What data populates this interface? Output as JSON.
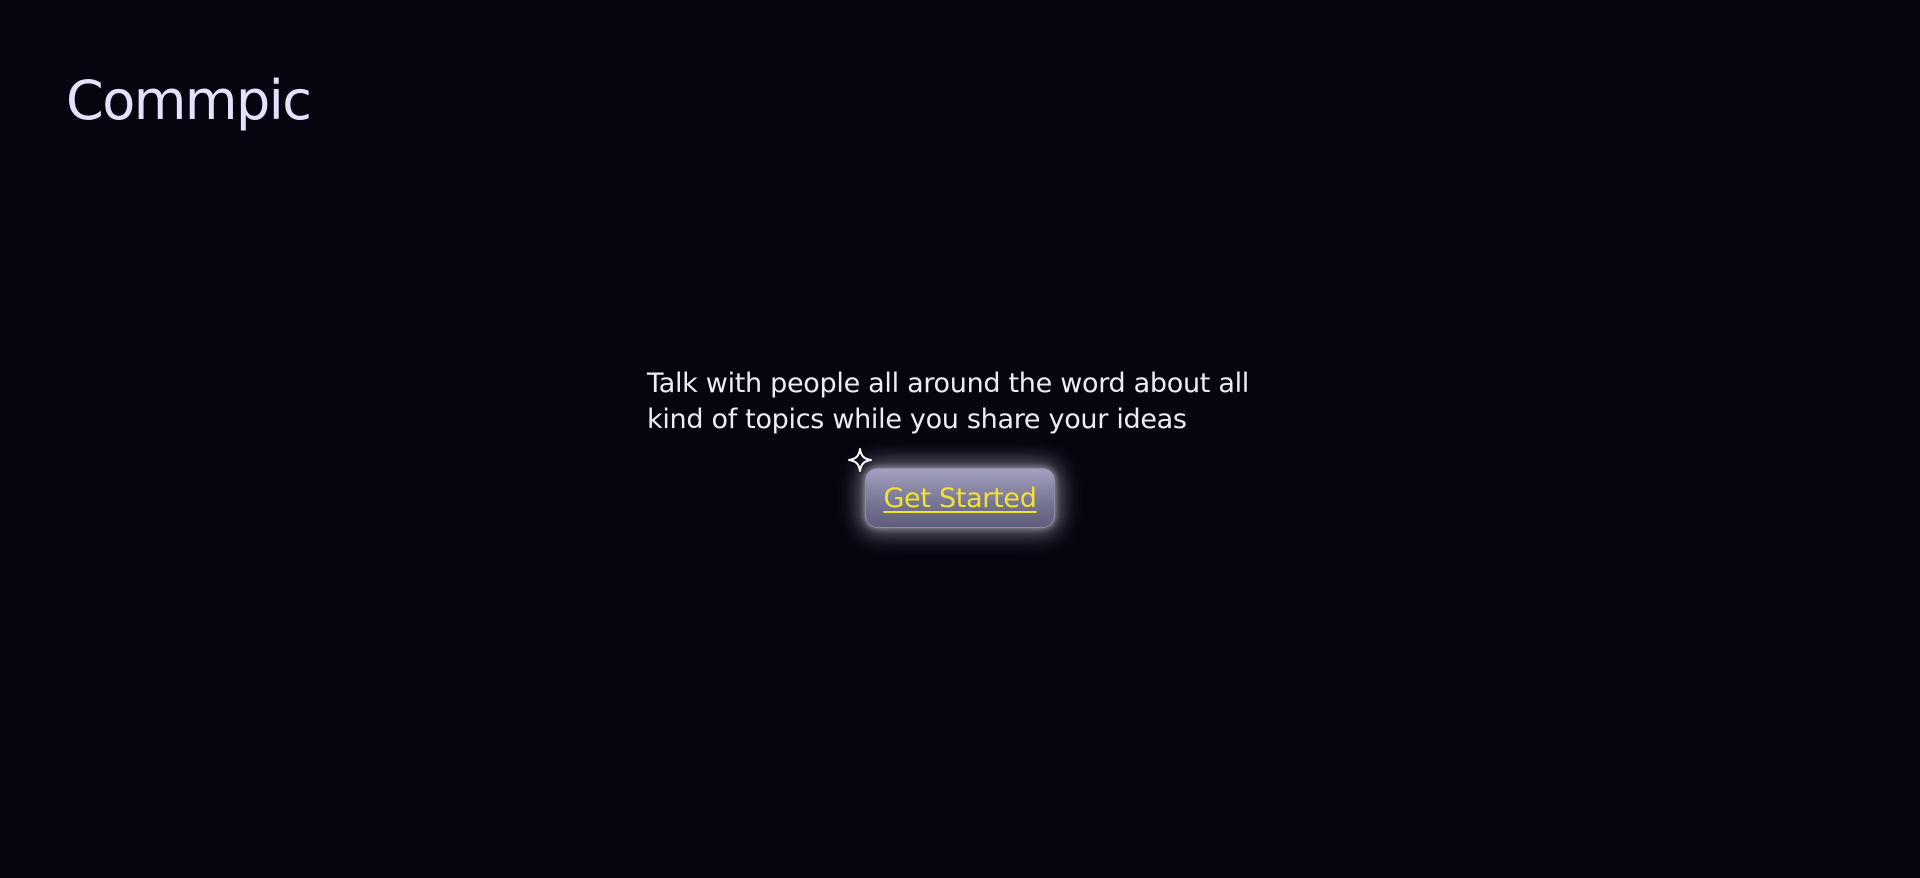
{
  "header": {
    "logo_text": "Commpic"
  },
  "hero": {
    "tagline": "Talk with people all around the word about all kind of topics while you share your ideas",
    "cta_label": "Get Started",
    "sparkle_icon": "sparkle-icon"
  },
  "colors": {
    "background": "#05040f",
    "logo": "#e4e2fb",
    "text": "#ecebf8",
    "cta_text": "#f3e034",
    "cta_bg": "#7a7897"
  }
}
